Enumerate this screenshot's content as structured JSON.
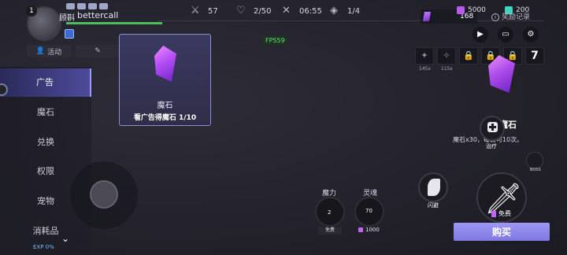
{
  "player": {
    "level": "1",
    "name": "bettercall",
    "name_prefix": "顾斟"
  },
  "stats": {
    "attack": "57",
    "hp": "2/50",
    "time": "06:55",
    "wave": "1/4"
  },
  "debug": {
    "fps": "FPS59"
  },
  "currencies": {
    "gems": "168",
    "gold": "5000",
    "crystals": "200",
    "record_label": "奖励记录"
  },
  "skill_cooldowns": [
    "145s",
    "115s"
  ],
  "skill_slot_count": "7",
  "top_tabs": [
    "活动",
    "",
    ""
  ],
  "sidebar": {
    "items": [
      {
        "label": "广告",
        "active": true
      },
      {
        "label": "魔石",
        "active": false
      },
      {
        "label": "兑换",
        "active": false
      },
      {
        "label": "权限",
        "active": false
      },
      {
        "label": "宠物",
        "active": false
      },
      {
        "label": "消耗品",
        "active": false
      }
    ]
  },
  "exp": "EXP 0%",
  "card": {
    "name": "魔石",
    "desc": "看广告得魔石 1/10"
  },
  "detail": {
    "title": "魔石",
    "desc": "魔石x30，每日可10次。"
  },
  "actions": {
    "heal": "治疗",
    "boss": "BOSS",
    "dodge": "闪避",
    "attack_free": "免费",
    "buy": "购买"
  },
  "potions": {
    "mana_label": "魔力",
    "mana_value": "2",
    "mana_free": "免费",
    "soul_label": "灵魂",
    "soul_value": "70",
    "soul_cost": "1000"
  },
  "colors": {
    "accent": "#8f8cd6",
    "buy_button": "#8f88ea",
    "hp_bar": "#4cbf5a",
    "fps_text": "#5fe07a"
  }
}
